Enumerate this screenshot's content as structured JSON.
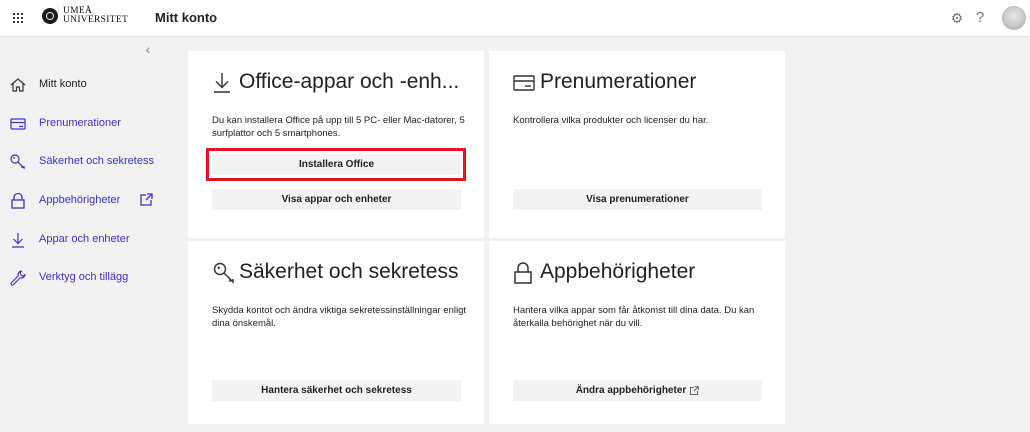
{
  "header": {
    "logo_line1": "UMEÅ",
    "logo_line2": "UNIVERSITET",
    "app_title": "Mitt konto",
    "settings_glyph": "⚙",
    "help_glyph": "?"
  },
  "sidebar": {
    "collapse_glyph": "‹",
    "items": [
      {
        "label": "Mitt konto",
        "icon": "home-icon"
      },
      {
        "label": "Prenumerationer",
        "icon": "card-icon"
      },
      {
        "label": "Säkerhet och sekretess",
        "icon": "key-icon"
      },
      {
        "label": "Appbehörigheter",
        "icon": "lock-icon"
      },
      {
        "label": "Appar och enheter",
        "icon": "download-icon"
      },
      {
        "label": "Verktyg och tillägg",
        "icon": "wrench-icon"
      }
    ]
  },
  "cards": {
    "office": {
      "title": "Office-appar och -enh...",
      "description": "Du kan installera Office på upp till 5 PC- eller Mac-datorer, 5 surfplattor och 5 smartphones.",
      "install_label": "Installera Office",
      "view_label": "Visa appar och enheter"
    },
    "subscriptions": {
      "title": "Prenumerationer",
      "description": "Kontrollera vilka produkter och licenser du har.",
      "view_label": "Visa prenumerationer"
    },
    "security": {
      "title": "Säkerhet och sekretess",
      "description": "Skydda kontot och ändra viktiga sekretessinställningar enligt dina önskemål.",
      "manage_label": "Hantera säkerhet och sekretess"
    },
    "permissions": {
      "title": "Appbehörigheter",
      "description": "Hantera vilka appar som får åtkomst till dina data. Du kan återkalla behörighet när du vill.",
      "change_label": "Ändra appbehörigheter"
    }
  },
  "colors": {
    "accent_link": "#3c33c9",
    "highlight": "#e3141d",
    "background": "#f2f2f2"
  }
}
